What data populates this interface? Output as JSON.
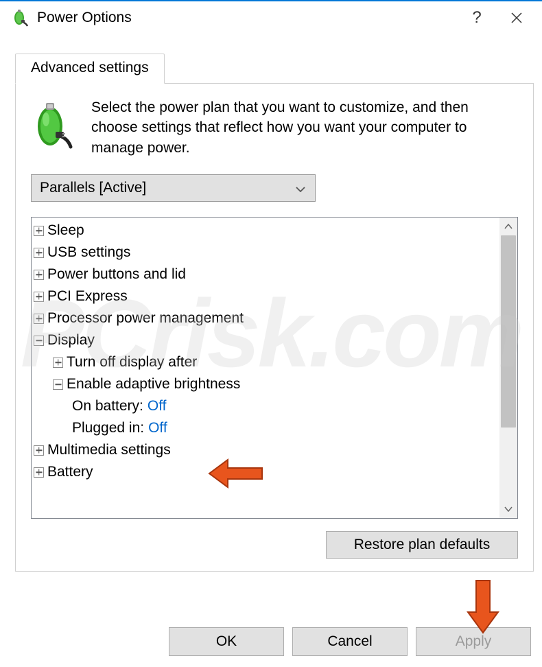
{
  "window": {
    "title": "Power Options"
  },
  "tab": {
    "label": "Advanced settings"
  },
  "intro": "Select the power plan that you want to customize, and then choose settings that reflect how you want your computer to manage power.",
  "plan_selector": {
    "selected": "Parallels [Active]"
  },
  "tree": {
    "items": [
      {
        "label": "Sleep",
        "expand": "plus",
        "indent": 0
      },
      {
        "label": "USB settings",
        "expand": "plus",
        "indent": 0
      },
      {
        "label": "Power buttons and lid",
        "expand": "plus",
        "indent": 0
      },
      {
        "label": "PCI Express",
        "expand": "plus",
        "indent": 0
      },
      {
        "label": "Processor power management",
        "expand": "plus",
        "indent": 0
      },
      {
        "label": "Display",
        "expand": "minus",
        "indent": 0
      },
      {
        "label": "Turn off display after",
        "expand": "plus",
        "indent": 1
      },
      {
        "label": "Enable adaptive brightness",
        "expand": "minus",
        "indent": 1
      },
      {
        "label": "On battery:",
        "value": "Off",
        "indent": 2
      },
      {
        "label": "Plugged in:",
        "value": "Off",
        "indent": 2
      },
      {
        "label": "Multimedia settings",
        "expand": "plus",
        "indent": 0
      },
      {
        "label": "Battery",
        "expand": "plus",
        "indent": 0
      }
    ]
  },
  "buttons": {
    "restore": "Restore plan defaults",
    "ok": "OK",
    "cancel": "Cancel",
    "apply": "Apply"
  },
  "watermark": "PCrisk.com"
}
